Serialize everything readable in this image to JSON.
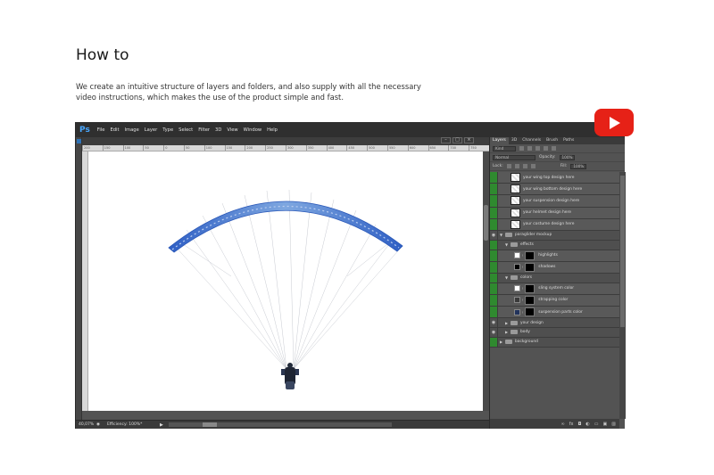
{
  "page": {
    "heading": "How to",
    "description": "We create an intuitive structure of layers and folders, and also supply with all the necessary video instructions, which makes the use of the product simple and fast."
  },
  "youtube": {
    "icon": "youtube-play-icon",
    "color": "#e62117"
  },
  "photoshop": {
    "logo": "Ps",
    "menu": [
      "File",
      "Edit",
      "Image",
      "Layer",
      "Type",
      "Select",
      "Filter",
      "3D",
      "View",
      "Window",
      "Help"
    ],
    "ruler_ticks": [
      "200",
      "150",
      "100",
      "50",
      "0",
      "50",
      "100",
      "150",
      "200",
      "250",
      "300",
      "350",
      "400",
      "450",
      "500",
      "550",
      "600",
      "650",
      "700",
      "750"
    ],
    "status": {
      "zoom": "40,07%",
      "efficiency": "Efficiency: 100%*"
    },
    "panel": {
      "tabs": [
        "Layers",
        "3D",
        "Channels",
        "Brush",
        "Paths"
      ],
      "kind": "Kind",
      "blend_mode": "Normal",
      "opacity_label": "Opacity:",
      "opacity_value": "100%",
      "lock_label": "Lock:",
      "fill_label": "Fill:",
      "fill_value": "100%",
      "layers": [
        {
          "name": "your wing top design here"
        },
        {
          "name": "your wing bottom design here"
        },
        {
          "name": "your suspension design here"
        },
        {
          "name": "your helmet design here"
        },
        {
          "name": "your costume design here"
        },
        {
          "name": "paraglider mockup"
        },
        {
          "name": "effects"
        },
        {
          "name": "highlights"
        },
        {
          "name": "shadows"
        },
        {
          "name": "colors"
        },
        {
          "name": "sling system color"
        },
        {
          "name": "strapping color"
        },
        {
          "name": "suspension parts color"
        },
        {
          "name": "your design"
        },
        {
          "name": "body"
        },
        {
          "name": "background"
        }
      ]
    }
  }
}
